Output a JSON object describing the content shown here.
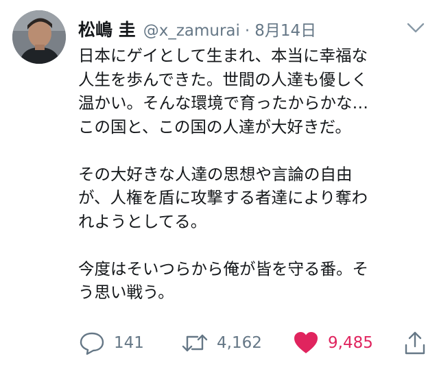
{
  "tweet": {
    "display_name": "松嶋 圭",
    "handle": "@x_zamurai",
    "separator": "·",
    "date": "8月14日",
    "paragraphs": [
      "日本にゲイとして生まれ、本当に幸福な\n人生を歩んできた。世間の人達も優しく\n温かい。そんな環境で育ったからかな…\nこの国と、この国の人達が大好きだ。",
      "その大好きな人達の思想や言論の自由\nが、人権を盾に攻撃する者達により奪わ\nれようとしてる。",
      "今度はそいつらから俺が皆を守る番。そ\nう思い戦う。"
    ],
    "actions": {
      "reply_count": "141",
      "retweet_count": "4,162",
      "like_count": "9,485"
    }
  },
  "colors": {
    "text": "#14171a",
    "secondary": "#657786",
    "like": "#e0245e"
  },
  "icons": {
    "avatar": "profile-photo",
    "menu": "chevron-down-icon",
    "reply": "reply-icon",
    "retweet": "retweet-icon",
    "like": "heart-icon",
    "share": "share-icon"
  }
}
